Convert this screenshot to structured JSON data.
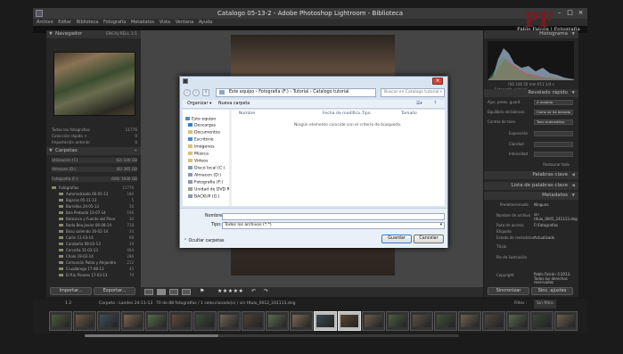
{
  "window": {
    "title": "Catalogo 05-13-2 - Adobe Photoshop Lightroom - Biblioteca",
    "minimize": "–",
    "maximize": "□",
    "close": "×"
  },
  "menu": [
    "Archivo",
    "Editar",
    "Biblioteca",
    "Fotografía",
    "Metadatos",
    "Vista",
    "Ventana",
    "Ayuda"
  ],
  "identity_plate": {
    "text": "Pablo Falcón | Fotografía",
    "logo": "PF"
  },
  "left_panel": {
    "navigator": {
      "title": "Navegador",
      "modes": "ENCAJ  RELL  1:1"
    },
    "catalog_rows": [
      {
        "label": "Todas las fotografías",
        "count": "11776"
      },
      {
        "label": "Colección rápida +",
        "count": "0"
      },
      {
        "label": "Importación anterior",
        "count": "0"
      }
    ],
    "folders": {
      "title": "Carpetas",
      "volumes": [
        {
          "label": "Utilización (C)",
          "count": "62/ 100 GB"
        },
        {
          "label": "Almacen (D:)",
          "count": "46/ 365 GB"
        },
        {
          "label": "Fotografía (F:)",
          "count": "600/ 1930 GB"
        }
      ],
      "items": [
        {
          "label": "Fotografías",
          "count": "11776"
        },
        {
          "label": "Automatizado 06-05-13",
          "count": "186"
        },
        {
          "label": "Bajaras 05-11-13",
          "count": "5"
        },
        {
          "label": "Barrellas 24-05-13",
          "count": "36"
        },
        {
          "label": "Bea Preboda 10-07-14",
          "count": "196"
        },
        {
          "label": "Belzunce y Fuente del Pinar",
          "count": "30"
        },
        {
          "label": "Boda Bea Javier 06-08-14",
          "count": "718"
        },
        {
          "label": "Boso saliendo 16-02-14",
          "count": "34"
        },
        {
          "label": "Calón 11-03-14",
          "count": "68"
        },
        {
          "label": "Carabaña 08-03-13",
          "count": "19"
        },
        {
          "label": "Cerceña 31-03-13",
          "count": "404"
        },
        {
          "label": "Cholo 19-02-14",
          "count": "286"
        },
        {
          "label": "Comunión Pablo y Alejandro",
          "count": "212"
        },
        {
          "label": "Cruzábrega 17-08-13",
          "count": "35"
        },
        {
          "label": "El Rio Pinares 17-03-13",
          "count": "79"
        }
      ]
    },
    "import_button": "Importar...",
    "export_button": "Exportar..."
  },
  "toolbar": {
    "stars": "★★★★★"
  },
  "right_panel": {
    "histogram": {
      "title": "Histograma",
      "readout": "ISO 100   50 mm   f/11   1/4 s",
      "original_label": "Fotografía original"
    },
    "quick_develop": {
      "title": "Revelado rápido",
      "rows": [
        {
          "label": "Ajus. prees. guard.",
          "value": "A medida"
        },
        {
          "label": "Equilibrio de blancos",
          "value": "Como se ha tomado"
        },
        {
          "label": "Control de tono",
          "value": "Tono automático"
        },
        {
          "label": "Exposición",
          "value": ""
        },
        {
          "label": "Claridad",
          "value": ""
        },
        {
          "label": "Intensidad",
          "value": ""
        }
      ],
      "reset_button": "Restaurar todo"
    },
    "keywording": {
      "title": "Palabras clave"
    },
    "keyword_list": {
      "title": "Lista de palabras clave"
    },
    "metadata": {
      "title": "Metadatos",
      "preset_label": "Predeterminado",
      "preset_value": "Ninguno",
      "rows": [
        {
          "label": "Nombre de archivo",
          "value": "sin título_0005_241113.dng"
        },
        {
          "label": "Ruta de acceso",
          "value": "F:\\Fotografías"
        },
        {
          "label": "Etiqueta",
          "value": ""
        },
        {
          "label": "Estado de metadatos",
          "value": "Actualizado"
        },
        {
          "label": "Título",
          "value": ""
        },
        {
          "label": "Pie de ilustración",
          "value": ""
        },
        {
          "label": "Copyright",
          "value": "Pablo Falcón ©2013. Todos los derechos reservados"
        }
      ]
    },
    "sync_button": "Sincronizar",
    "sync_settings_button": "Sinc. ajustes"
  },
  "filmstrip": {
    "pages": "1  2",
    "source": "Carpeta : Landes 24-11-13",
    "status": "70 de 88 fotografías / 1 seleccionado(s) / sin título_0012_241113.dng",
    "filter_label": "Filtro :",
    "filter_value": "Sin filtro"
  },
  "dialog": {
    "breadcrumb": "Este equipo  ›  Fotografía (F:)  ›  Tutorial  ›  Catalogo tutorial",
    "search_placeholder": "Buscar en Catalogo tutorial",
    "organize": "Organizar ▾",
    "new_folder": "Nueva carpeta",
    "nav_items": [
      "Este equipo",
      "Descargas",
      "Documentos",
      "Escritorio",
      "Imágenes",
      "Música",
      "Vídeos",
      "Disco local (C:)",
      "Almacen (D:)",
      "Fotografía (F:)",
      "Unidad de DVD R",
      "BACKUP (G:)"
    ],
    "columns": [
      "Nombre",
      "Fecha de modifica...",
      "Tipo",
      "Tamaño"
    ],
    "empty_message": "Ningún elemento coincide con el criterio de búsqueda.",
    "name_label": "Nombre:",
    "name_value": "",
    "type_label": "Tipo:",
    "type_value": "Todos los archivos (*.*)",
    "hide_folders": "Ocultar carpetas",
    "save_button": "Guardar",
    "cancel_button": "Cancelar"
  }
}
